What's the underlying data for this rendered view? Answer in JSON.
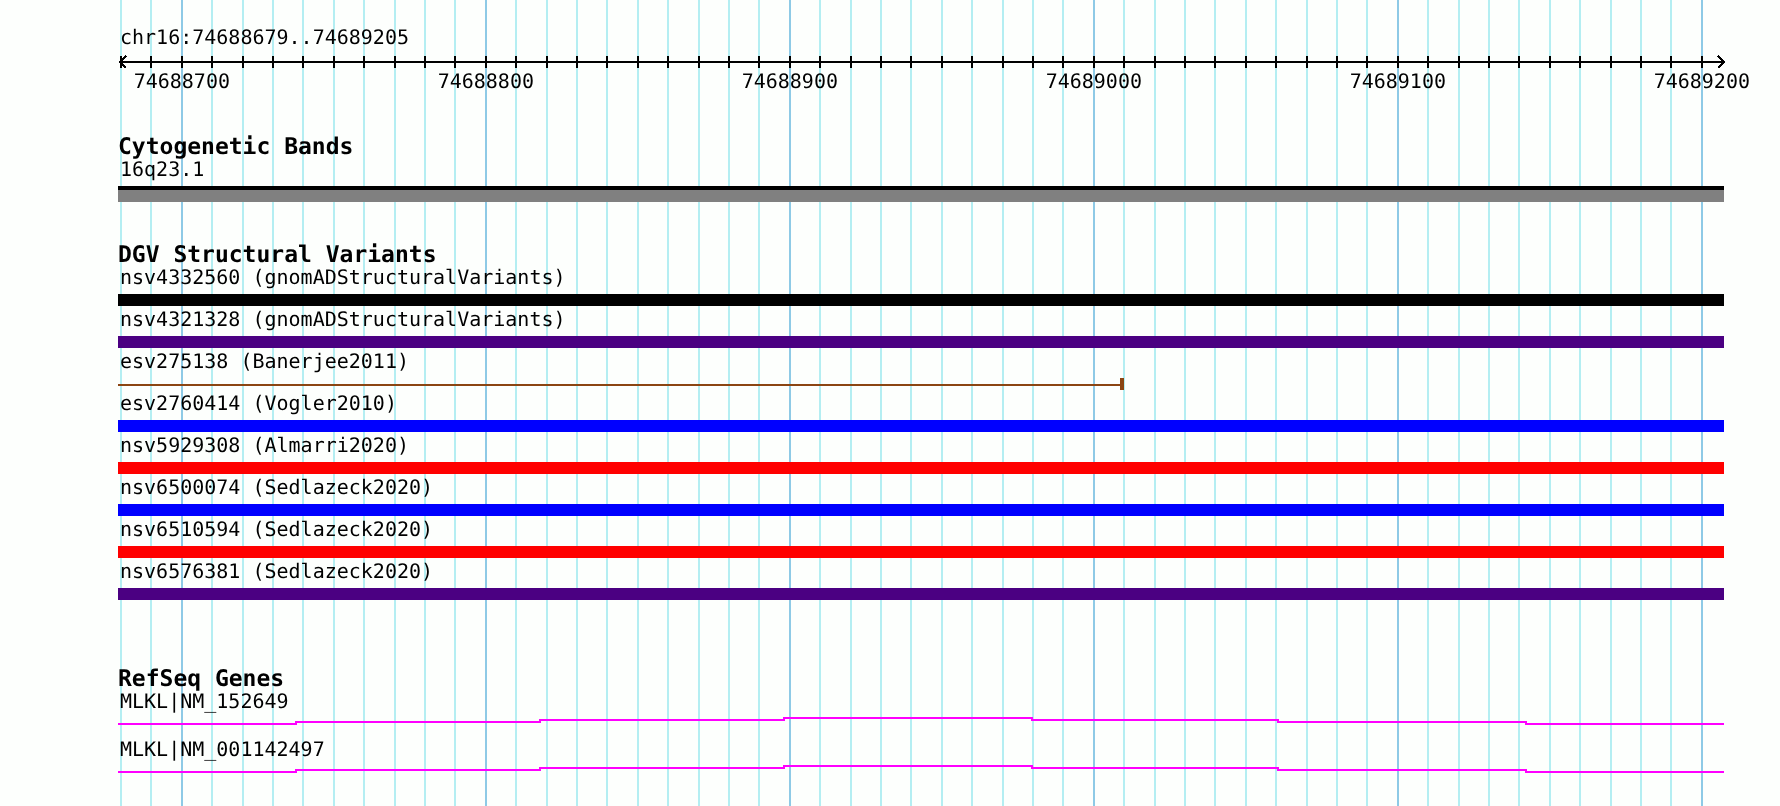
{
  "ruler": {
    "region": "chr16:74688679..74689205",
    "ticks": [
      "74688700",
      "74688800",
      "74688900",
      "74689000",
      "74689100",
      "74689200"
    ]
  },
  "cytogenetic_bands": {
    "title": "Cytogenetic Bands",
    "band": "16q23.1"
  },
  "dgv_structural_variants": {
    "title": "DGV Structural Variants",
    "variants": [
      {
        "label": "nsv4332560 (gnomADStructuralVariants)",
        "kind": "bar",
        "color": "#000000"
      },
      {
        "label": "nsv4321328 (gnomADStructuralVariants)",
        "kind": "bar",
        "color": "#4b0082"
      },
      {
        "label": "esv275138 (Banerjee2011)",
        "kind": "line",
        "color": "#8b4513"
      },
      {
        "label": "esv2760414 (Vogler2010)",
        "kind": "bar",
        "color": "#0000ff"
      },
      {
        "label": "nsv5929308 (Almarri2020)",
        "kind": "bar",
        "color": "#ff0000"
      },
      {
        "label": "nsv6500074 (Sedlazeck2020)",
        "kind": "bar",
        "color": "#0000ff"
      },
      {
        "label": "nsv6510594 (Sedlazeck2020)",
        "kind": "bar",
        "color": "#ff0000"
      },
      {
        "label": "nsv6576381 (Sedlazeck2020)",
        "kind": "bar",
        "color": "#4b0082"
      }
    ]
  },
  "refseq_genes": {
    "title": "RefSeq Genes",
    "genes": [
      {
        "label": "MLKL|NM_152649"
      },
      {
        "label": "MLKL|NM_001142497"
      }
    ]
  }
}
